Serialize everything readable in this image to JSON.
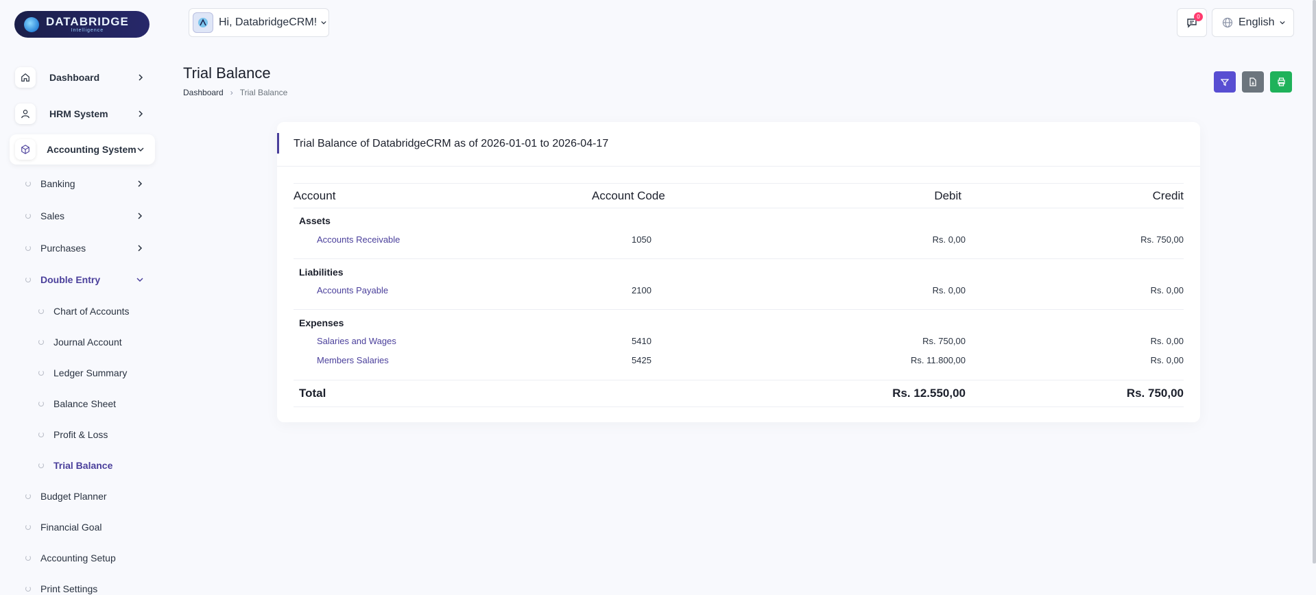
{
  "brand": {
    "title": "DATABRIDGE",
    "subtitle": "Intelligence"
  },
  "sidebar": {
    "main": [
      {
        "label": "Dashboard",
        "icon": "home-icon"
      },
      {
        "label": "HRM System",
        "icon": "user-icon"
      },
      {
        "label": "Accounting System",
        "icon": "box-icon"
      }
    ],
    "accounting": [
      {
        "label": "Banking"
      },
      {
        "label": "Sales"
      },
      {
        "label": "Purchases"
      },
      {
        "label": "Double Entry"
      }
    ],
    "double_entry": [
      {
        "label": "Chart of Accounts"
      },
      {
        "label": "Journal Account"
      },
      {
        "label": "Ledger Summary"
      },
      {
        "label": "Balance Sheet"
      },
      {
        "label": "Profit & Loss"
      },
      {
        "label": "Trial Balance"
      }
    ],
    "more": [
      {
        "label": "Budget Planner"
      },
      {
        "label": "Financial Goal"
      },
      {
        "label": "Accounting Setup"
      },
      {
        "label": "Print Settings"
      }
    ]
  },
  "header": {
    "user_greeting": "Hi, DatabridgeCRM!",
    "notification_count": "0",
    "language": "English"
  },
  "page": {
    "title": "Trial Balance",
    "breadcrumb": {
      "home": "Dashboard",
      "current": "Trial Balance"
    }
  },
  "actions": {
    "filter_color": "#584ed2",
    "export_color": "#6c757d",
    "print_color": "#1fb25a"
  },
  "report": {
    "title": "Trial Balance of DatabridgeCRM as of 2026-01-01 to 2026-04-17",
    "columns": {
      "account": "Account",
      "code": "Account Code",
      "debit": "Debit",
      "credit": "Credit"
    },
    "groups": [
      {
        "name": "Assets",
        "rows": [
          {
            "account": "Accounts Receivable",
            "code": "1050",
            "debit": "Rs. 0,00",
            "credit": "Rs. 750,00"
          }
        ]
      },
      {
        "name": "Liabilities",
        "rows": [
          {
            "account": "Accounts Payable",
            "code": "2100",
            "debit": "Rs. 0,00",
            "credit": "Rs. 0,00"
          }
        ]
      },
      {
        "name": "Expenses",
        "rows": [
          {
            "account": "Salaries and Wages",
            "code": "5410",
            "debit": "Rs. 750,00",
            "credit": "Rs. 0,00"
          },
          {
            "account": "Members Salaries",
            "code": "5425",
            "debit": "Rs. 11.800,00",
            "credit": "Rs. 0,00"
          }
        ]
      }
    ],
    "total": {
      "label": "Total",
      "debit": "Rs. 12.550,00",
      "credit": "Rs. 750,00"
    }
  }
}
